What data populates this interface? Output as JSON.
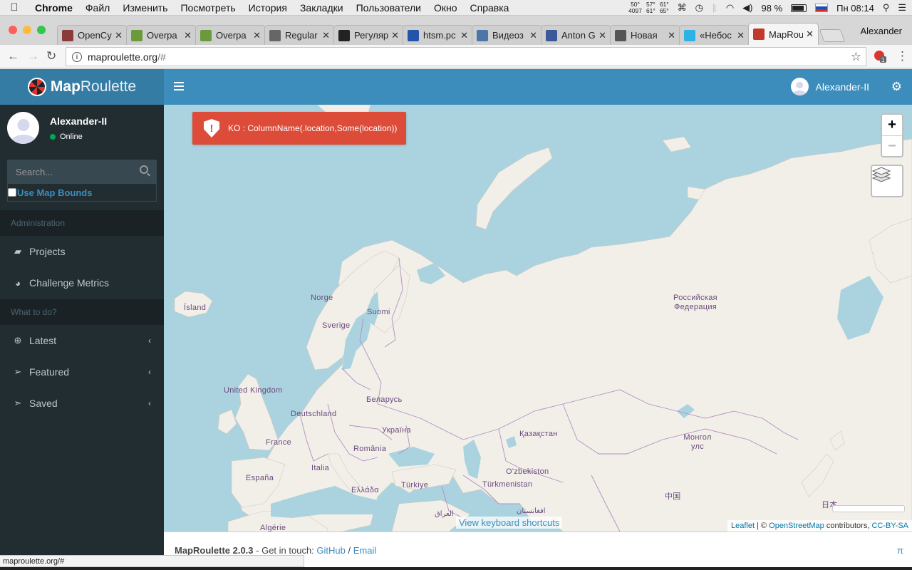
{
  "os_menu": {
    "app": "Chrome",
    "items": [
      "Файл",
      "Изменить",
      "Посмотреть",
      "История",
      "Закладки",
      "Пользователи",
      "Окно",
      "Справка"
    ],
    "temps": [
      [
        "50°",
        "4097"
      ],
      [
        "57°",
        "61°"
      ],
      [
        "61°",
        "65°"
      ]
    ],
    "battery": "98 %",
    "clock": "Пн 08:14",
    "flag_colors": [
      "#ffffff",
      "#1c4fb5",
      "#d52b1e"
    ]
  },
  "browser": {
    "tabs": [
      {
        "title": "OpenCy",
        "icon": "opency-favicon",
        "color": "#8b3a3a"
      },
      {
        "title": "Overpa",
        "icon": "overpass-favicon",
        "color": "#6a9a3a"
      },
      {
        "title": "Overpa",
        "icon": "overpass-favicon",
        "color": "#6a9a3a"
      },
      {
        "title": "Regular",
        "icon": "document-favicon",
        "color": "#666666"
      },
      {
        "title": "Регуляр",
        "icon": "wikipedia-favicon",
        "color": "#222222"
      },
      {
        "title": "htsm.pc",
        "icon": "htsm-favicon",
        "color": "#2255aa"
      },
      {
        "title": "Видеоз",
        "icon": "vk-favicon",
        "color": "#4a76a8"
      },
      {
        "title": "Anton G",
        "icon": "facebook-favicon",
        "color": "#3b5998"
      },
      {
        "title": "Новая",
        "icon": "plane-favicon",
        "color": "#555555"
      },
      {
        "title": "«Небос",
        "icon": "h-favicon",
        "color": "#2bb3e6"
      },
      {
        "title": "MapRou",
        "icon": "maproulette-favicon",
        "color": "#c0392b"
      }
    ],
    "profile": "Alexander",
    "url_host": "maproulette.org",
    "url_path": "/#"
  },
  "app": {
    "logo_bold": "Map",
    "logo_light": "Roulette",
    "header_user": "Alexander-II"
  },
  "sidebar": {
    "user_name": "Alexander-II",
    "status": "Online",
    "search_placeholder": "Search...",
    "bounds_label": "Use Map Bounds",
    "sections": [
      {
        "label": "Administration"
      },
      {
        "label": "What to do?"
      }
    ],
    "admin_items": [
      {
        "label": "Projects",
        "icon": "folder-open-icon"
      },
      {
        "label": "Challenge Metrics",
        "icon": "pie-chart-icon"
      }
    ],
    "todo_items": [
      {
        "label": "Latest",
        "icon": "plus-circle-icon"
      },
      {
        "label": "Featured",
        "icon": "paper-plane-icon"
      },
      {
        "label": "Saved",
        "icon": "paper-plane-outline-icon"
      }
    ]
  },
  "map": {
    "alert": "KO : ColumnName(.location,Some(location))",
    "labels": [
      "Ísland",
      "Norge",
      "Sverige",
      "Suomi",
      "Российская Федерация",
      "United Kingdom",
      "Deutschland",
      "Беларусь",
      "Україна",
      "France",
      "România",
      "Қазақстан",
      "Монгол улс",
      "España",
      "Italia",
      "Ελλάδα",
      "Türkiye",
      "O'zbekiston",
      "Türkmenistan",
      "中国",
      "Algérie",
      "العراق",
      "افغانستان",
      "日本"
    ],
    "kbd_link": "View keyboard shortcuts",
    "attribution": {
      "leaflet": "Leaflet",
      "sep": " | © ",
      "osm": "OpenStreetMap",
      "mid": " contributors, ",
      "license": "CC-BY-SA"
    },
    "zoom_in": "+",
    "zoom_out": "−"
  },
  "footer": {
    "version": "MapRoulette 2.0.3",
    "touch": " - Get in touch: ",
    "github": "GitHub",
    "slash": " / ",
    "email": "Email",
    "pi": "π"
  },
  "status_url": "maproulette.org/#"
}
